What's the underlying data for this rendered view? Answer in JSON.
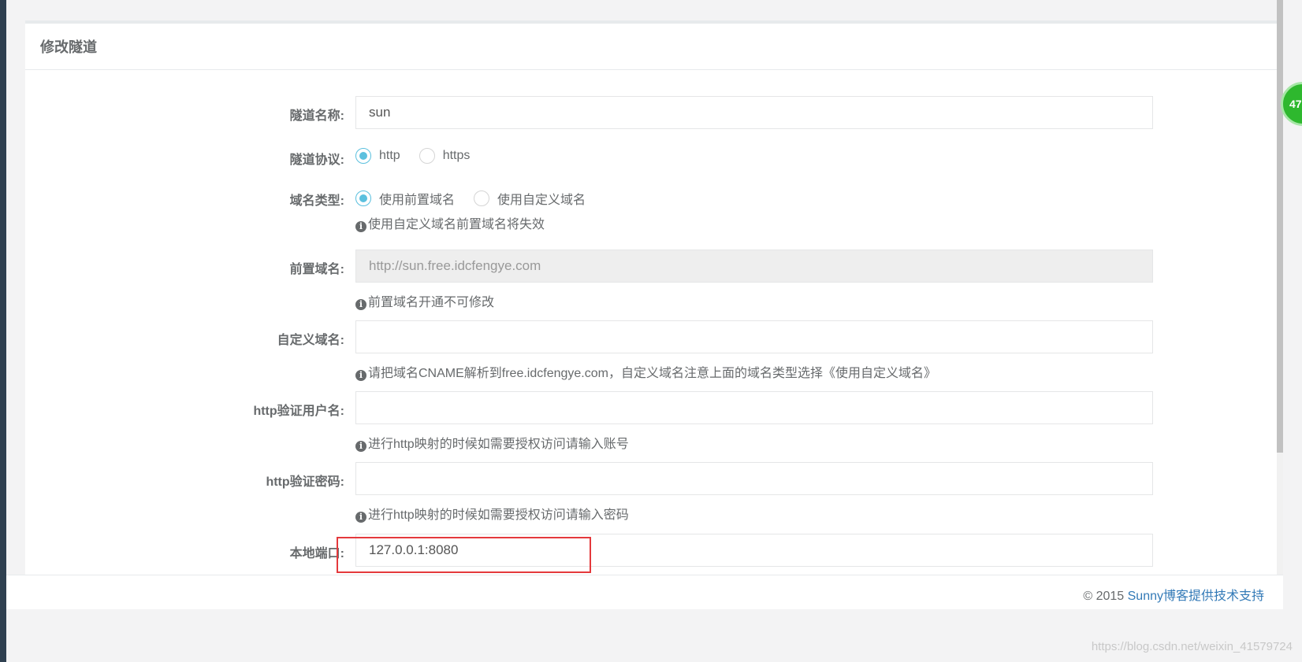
{
  "panel": {
    "title": "修改隧道"
  },
  "form": {
    "tunnel_name": {
      "label": "隧道名称:",
      "value": "sun"
    },
    "protocol": {
      "label": "隧道协议:",
      "options": [
        {
          "label": "http",
          "checked": true
        },
        {
          "label": "https",
          "checked": false
        }
      ]
    },
    "domain_type": {
      "label": "域名类型:",
      "options": [
        {
          "label": "使用前置域名",
          "checked": true
        },
        {
          "label": "使用自定义域名",
          "checked": false
        }
      ],
      "help": "使用自定义域名前置域名将失效"
    },
    "prefix_domain": {
      "label": "前置域名:",
      "value": "http://sun.free.idcfengye.com",
      "help": "前置域名开通不可修改"
    },
    "custom_domain": {
      "label": "自定义域名:",
      "value": "",
      "help": "请把域名CNAME解析到free.idcfengye.com，自定义域名注意上面的域名类型选择《使用自定义域名》"
    },
    "http_user": {
      "label": "http验证用户名:",
      "value": "",
      "help": "进行http映射的时候如需要授权访问请输入账号"
    },
    "http_password": {
      "label": "http验证密码:",
      "value": "",
      "help": "进行http映射的时候如需要授权访问请输入密码"
    },
    "local_port": {
      "label": "本地端口:",
      "value": "127.0.0.1:8080"
    }
  },
  "footer": {
    "copyright": "© 2015 ",
    "link": "Sunny博客提供技术支持"
  },
  "badge": {
    "text": "47"
  },
  "watermark": "https://blog.csdn.net/weixin_41579724",
  "icons": {
    "info": "i"
  },
  "colors": {
    "radio_checked": "#5bc0de",
    "highlight": "#e4393c",
    "link": "#337ab7"
  }
}
